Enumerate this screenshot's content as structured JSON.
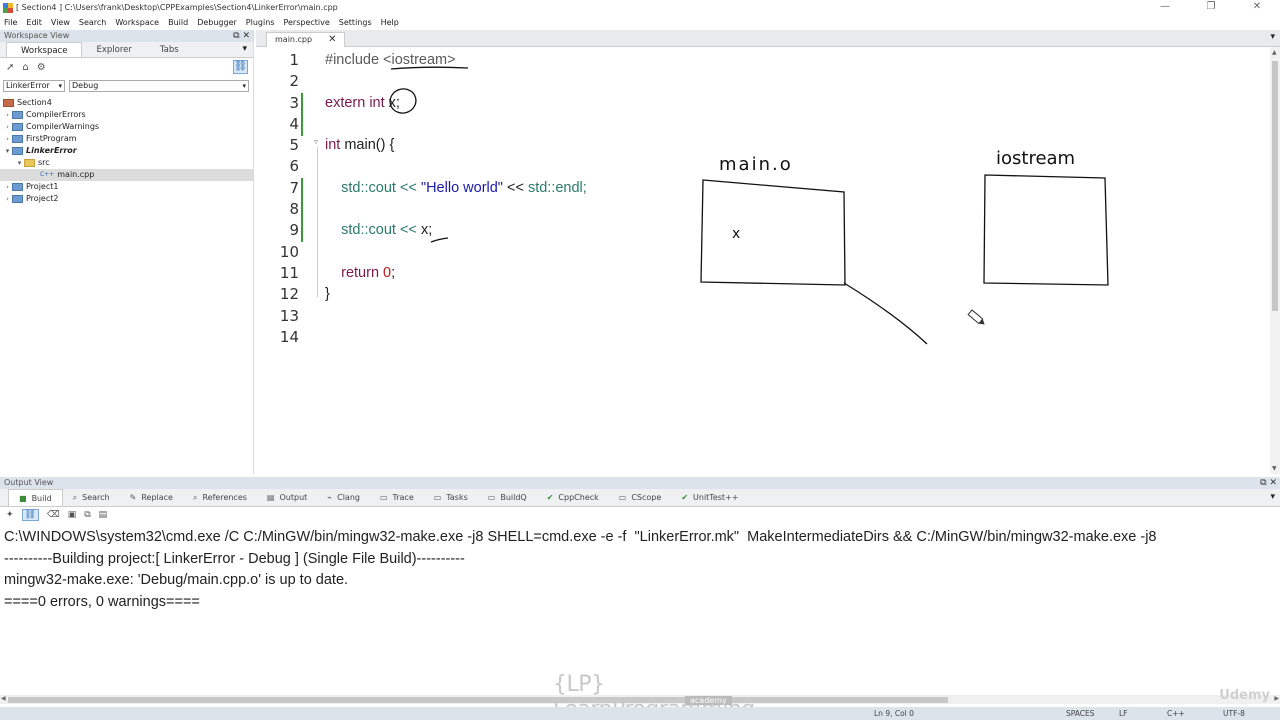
{
  "window": {
    "title": "[ Section4 ] C:\\Users\\frank\\Desktop\\CPPExamples\\Section4\\LinkerError\\main.cpp",
    "controls": {
      "minimize": "—",
      "restore": "❐",
      "close": "✕"
    }
  },
  "menu": [
    "File",
    "Edit",
    "View",
    "Search",
    "Workspace",
    "Build",
    "Debugger",
    "Plugins",
    "Perspective",
    "Settings",
    "Help"
  ],
  "workspace": {
    "header": "Workspace View",
    "tabs": [
      "Workspace",
      "Explorer",
      "Tabs"
    ],
    "project_combo": "LinkerError",
    "config_combo": "Debug",
    "tree": {
      "root": "Section4",
      "items": [
        {
          "label": "CompilerErrors"
        },
        {
          "label": "CompilerWarnings"
        },
        {
          "label": "FirstProgram"
        },
        {
          "label": "LinkerError"
        },
        {
          "label": "src"
        },
        {
          "label": "main.cpp"
        },
        {
          "label": "Project1"
        },
        {
          "label": "Project2"
        }
      ],
      "file_icon_text": "C++"
    }
  },
  "editor": {
    "tab_label": "main.cpp",
    "line_numbers": [
      "1",
      "2",
      "3",
      "4",
      "5",
      "6",
      "7",
      "8",
      "9",
      "10",
      "11",
      "12",
      "13",
      "14"
    ],
    "code": {
      "l1_pp": "#include ",
      "l1_hdr": "<iostream>",
      "l3_kw": "extern int ",
      "l3_rest": "x;",
      "l5_kw": "int ",
      "l5_rest": "main() {",
      "l7_ns1": "std::",
      "l7_a": "cout << ",
      "l7_str": "\"Hello world\"",
      "l7_b": " << ",
      "l7_ns2": "std::",
      "l7_c": "endl;",
      "l9_ns": "std::",
      "l9_a": "cout << ",
      "l9_b": "x;",
      "l11_kw": "return ",
      "l11_num": "0",
      "l11_end": ";",
      "l12": "}"
    },
    "annotations": {
      "box1_label": "main.o",
      "box1_content": "x",
      "box2_label": "iostream"
    }
  },
  "output": {
    "header": "Output View",
    "tabs": [
      "Build",
      "Search",
      "Replace",
      "References",
      "Output",
      "Clang",
      "Trace",
      "Tasks",
      "BuildQ",
      "CppCheck",
      "CScope",
      "UnitTest++"
    ],
    "lines": [
      "C:\\WINDOWS\\system32\\cmd.exe /C C:/MinGW/bin/mingw32-make.exe -j8 SHELL=cmd.exe -e -f  \"LinkerError.mk\"  MakeIntermediateDirs && C:/MinGW/bin/mingw32-make.exe -j8",
      "----------Building project:[ LinkerError - Debug ] (Single File Build)----------",
      "mingw32-make.exe: 'Debug/main.cpp.o' is up to date.",
      "====0 errors, 0 warnings===="
    ]
  },
  "watermark": {
    "brand": "{LP} LearnProgramming",
    "sub": "academy",
    "udemy": "Udemy"
  },
  "status": {
    "position": "Ln 9, Col 0",
    "indent": "SPACES",
    "eol": "LF",
    "lang": "C++",
    "encoding": "UTF-8"
  },
  "colors": {
    "accent_blue": "#2a66b0",
    "change_bar": "#3a9a3a",
    "keyword": "#7a1a4d",
    "string": "#1a1aa6",
    "number": "#c21818"
  }
}
